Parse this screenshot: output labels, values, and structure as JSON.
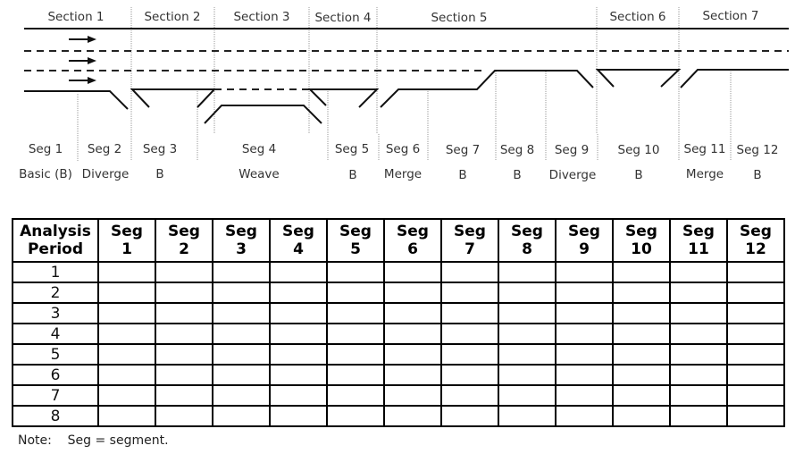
{
  "diagram": {
    "sections": [
      "Section 1",
      "Section 2",
      "Section 3",
      "Section 4",
      "Section 5",
      "Section 6",
      "Section 7"
    ],
    "segments": [
      {
        "label": "Seg 1",
        "type": "Basic (B)"
      },
      {
        "label": "Seg 2",
        "type": "Diverge"
      },
      {
        "label": "Seg 3",
        "type": "B"
      },
      {
        "label": "Seg 4",
        "type": "Weave"
      },
      {
        "label": "Seg 5",
        "type": "B"
      },
      {
        "label": "Seg 6",
        "type": "Merge"
      },
      {
        "label": "Seg 7",
        "type": "B"
      },
      {
        "label": "Seg 8",
        "type": "B"
      },
      {
        "label": "Seg 9",
        "type": "Diverge"
      },
      {
        "label": "Seg 10",
        "type": "B"
      },
      {
        "label": "Seg 11",
        "type": "Merge"
      },
      {
        "label": "Seg 12",
        "type": "B"
      }
    ],
    "travel_direction_icon": "right-arrow"
  },
  "table": {
    "header_first": [
      "Analysis",
      "Period"
    ],
    "seg_header_top": "Seg",
    "seg_numbers": [
      "1",
      "2",
      "3",
      "4",
      "5",
      "6",
      "7",
      "8",
      "9",
      "10",
      "11",
      "12"
    ],
    "periods": [
      "1",
      "2",
      "3",
      "4",
      "5",
      "6",
      "7",
      "8"
    ]
  },
  "note": "Note:    Seg = segment."
}
